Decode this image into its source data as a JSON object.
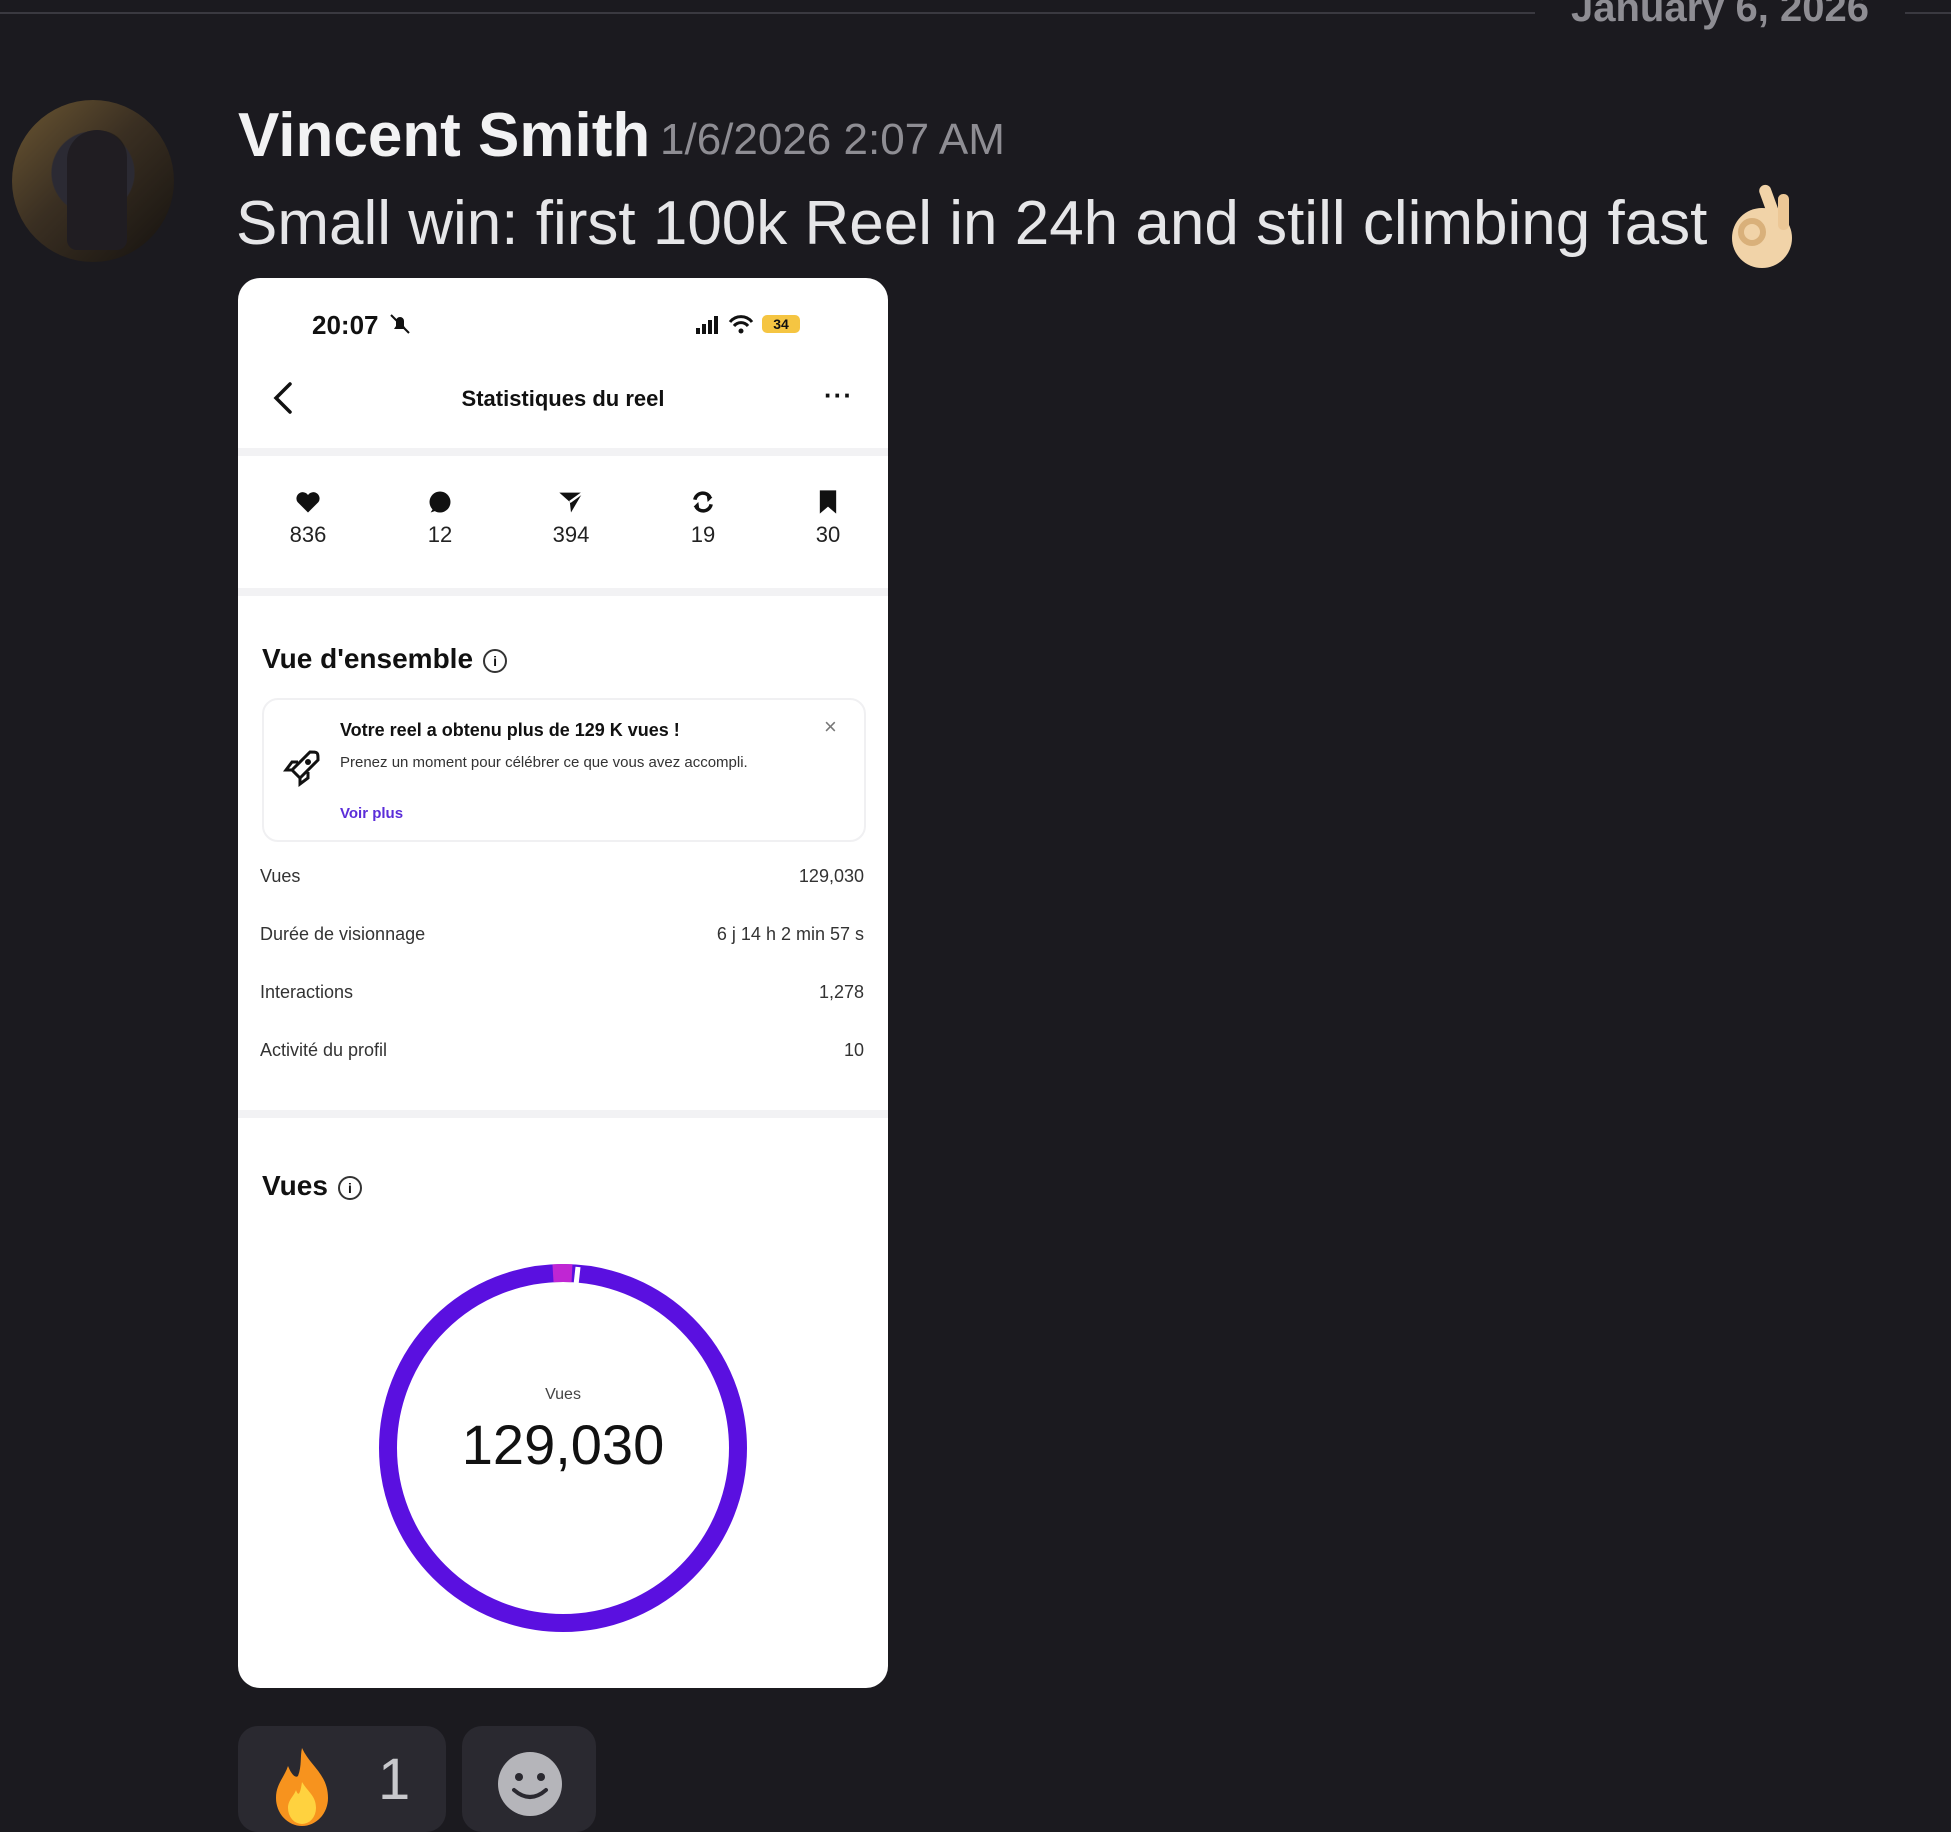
{
  "divider": {
    "date": "January 6, 2026"
  },
  "message": {
    "author": "Vincent Smith",
    "timestamp": "1/6/2026 2:07 AM",
    "text": "Small win: first 100k Reel in 24h and still climbing fast",
    "emoji_icon": "ok-hand-icon"
  },
  "attachment": {
    "status_time": "20:07",
    "battery": "34",
    "title": "Statistiques du reel",
    "more": "···",
    "stats": [
      {
        "icon": "heart-icon",
        "value": "836"
      },
      {
        "icon": "comment-icon",
        "value": "12"
      },
      {
        "icon": "share-icon",
        "value": "394"
      },
      {
        "icon": "repost-icon",
        "value": "19"
      },
      {
        "icon": "bookmark-icon",
        "value": "30"
      }
    ],
    "overview": {
      "title": "Vue d'ensemble",
      "notice_title": "Votre reel a obtenu plus de 129 K vues !",
      "notice_body": "Prenez un moment pour célébrer ce que vous avez accompli.",
      "notice_link": "Voir plus",
      "close": "×",
      "rows": [
        {
          "label": "Vues",
          "value": "129,030"
        },
        {
          "label": "Durée de visionnage",
          "value": "6 j 14 h 2 min 57 s"
        },
        {
          "label": "Interactions",
          "value": "1,278"
        },
        {
          "label": "Activité du profil",
          "value": "10"
        }
      ]
    },
    "views": {
      "title": "Vues",
      "ring_label": "Vues",
      "ring_value": "129,030",
      "accent_color": "#5a10e0",
      "highlight_color": "#c026d3"
    }
  },
  "reactions": [
    {
      "icon": "fire-icon",
      "count": "1"
    },
    {
      "icon": "add-reaction-icon"
    }
  ]
}
